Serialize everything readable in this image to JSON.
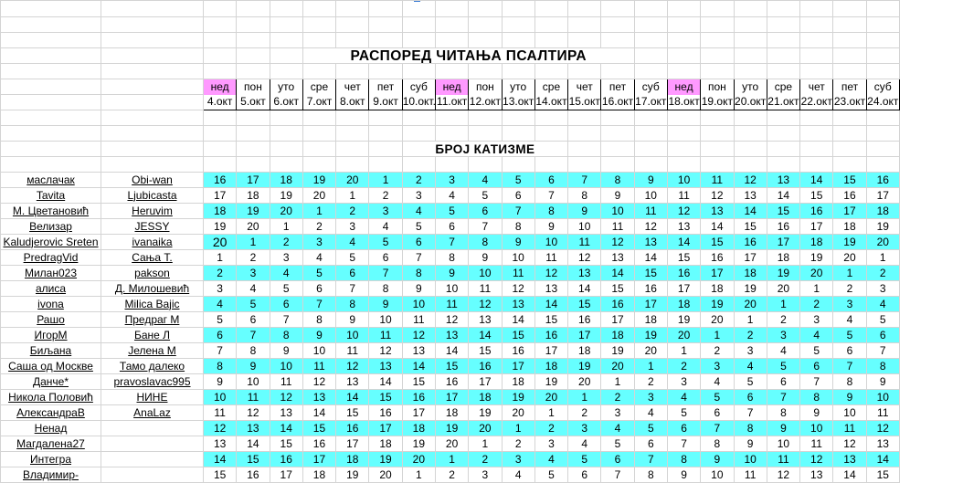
{
  "title": "РАСПОРЕД  ЧИТАЊА  ПСАЛТИРА",
  "subtitle": "БРОЈ  КАТИЗМЕ",
  "days": [
    {
      "day": "нед",
      "date": "4.окт",
      "sunday": true
    },
    {
      "day": "пон",
      "date": "5.окт",
      "sunday": false
    },
    {
      "day": "уто",
      "date": "6.окт",
      "sunday": false
    },
    {
      "day": "сре",
      "date": "7.окт",
      "sunday": false
    },
    {
      "day": "чет",
      "date": "8.окт",
      "sunday": false
    },
    {
      "day": "пет",
      "date": "9.окт",
      "sunday": false
    },
    {
      "day": "суб",
      "date": "10.окт.",
      "sunday": false
    },
    {
      "day": "нед",
      "date": "11.окт",
      "sunday": true
    },
    {
      "day": "пон",
      "date": "12.окт",
      "sunday": false
    },
    {
      "day": "уто",
      "date": "13.окт",
      "sunday": false
    },
    {
      "day": "сре",
      "date": "14.окт",
      "sunday": false
    },
    {
      "day": "чет",
      "date": "15.окт",
      "sunday": false
    },
    {
      "day": "пет",
      "date": "16.окт",
      "sunday": false
    },
    {
      "day": "суб",
      "date": "17.окт",
      "sunday": false
    },
    {
      "day": "нед",
      "date": "18.окт",
      "sunday": true
    },
    {
      "day": "пон",
      "date": "19.окт",
      "sunday": false
    },
    {
      "day": "уто",
      "date": "20.окт",
      "sunday": false
    },
    {
      "day": "сре",
      "date": "21.окт",
      "sunday": false
    },
    {
      "day": "чет",
      "date": "22.окт",
      "sunday": false
    },
    {
      "day": "пет",
      "date": "23.окт",
      "sunday": false
    },
    {
      "day": "суб",
      "date": "24.окт",
      "sunday": false
    }
  ],
  "rows": [
    {
      "name": "маслачак",
      "nick": "Obi-wan",
      "start": 16,
      "cyan": true
    },
    {
      "name": "Tavita",
      "nick": "Ljubicasta",
      "start": 17,
      "cyan": false
    },
    {
      "name": "М. Цветановић",
      "nick": "Heruvim",
      "start": 18,
      "cyan": true
    },
    {
      "name": "Велизар",
      "nick": "JESSY",
      "start": 19,
      "cyan": false
    },
    {
      "name": "Kaludjerovic Sreten",
      "nick": "ivanaika",
      "start": 20,
      "cyan": true,
      "big_first": true
    },
    {
      "name": "PredragVid",
      "nick": "Сања Т.",
      "start": 1,
      "cyan": false
    },
    {
      "name": "Милан023",
      "nick": "pakson",
      "start": 2,
      "cyan": true
    },
    {
      "name": "алиса",
      "nick": "Д. Милошевић",
      "start": 3,
      "cyan": false
    },
    {
      "name": "ivona",
      "nick": "Milica Bajic",
      "start": 4,
      "cyan": true
    },
    {
      "name": "Рашо",
      "nick": "Предраг М",
      "start": 5,
      "cyan": false
    },
    {
      "name": "ИгорМ",
      "nick": "Бане Л",
      "start": 6,
      "cyan": true
    },
    {
      "name": "Биљана",
      "nick": "Јелена М",
      "start": 7,
      "cyan": false
    },
    {
      "name": "Саша од Москве",
      "nick": "Тамо далеко",
      "start": 8,
      "cyan": true
    },
    {
      "name": "Данче*",
      "nick": "pravoslavac995",
      "start": 9,
      "cyan": false
    },
    {
      "name": "Никола Половић",
      "nick": "НИНЕ",
      "start": 10,
      "cyan": true
    },
    {
      "name": "АлександраВ",
      "nick": "AnaLaz",
      "start": 11,
      "cyan": false
    },
    {
      "name": "Ненад",
      "nick": "",
      "start": 12,
      "cyan": true
    },
    {
      "name": "Магдалена27",
      "nick": "",
      "start": 13,
      "cyan": false
    },
    {
      "name": "Интегра",
      "nick": "",
      "start": 14,
      "cyan": true
    },
    {
      "name": "Владимир-",
      "nick": "",
      "start": 15,
      "cyan": false
    }
  ],
  "colors": {
    "sunday_header": "#ff99ff",
    "row_highlight": "#66ffff",
    "grid": "#d4d4d4"
  }
}
